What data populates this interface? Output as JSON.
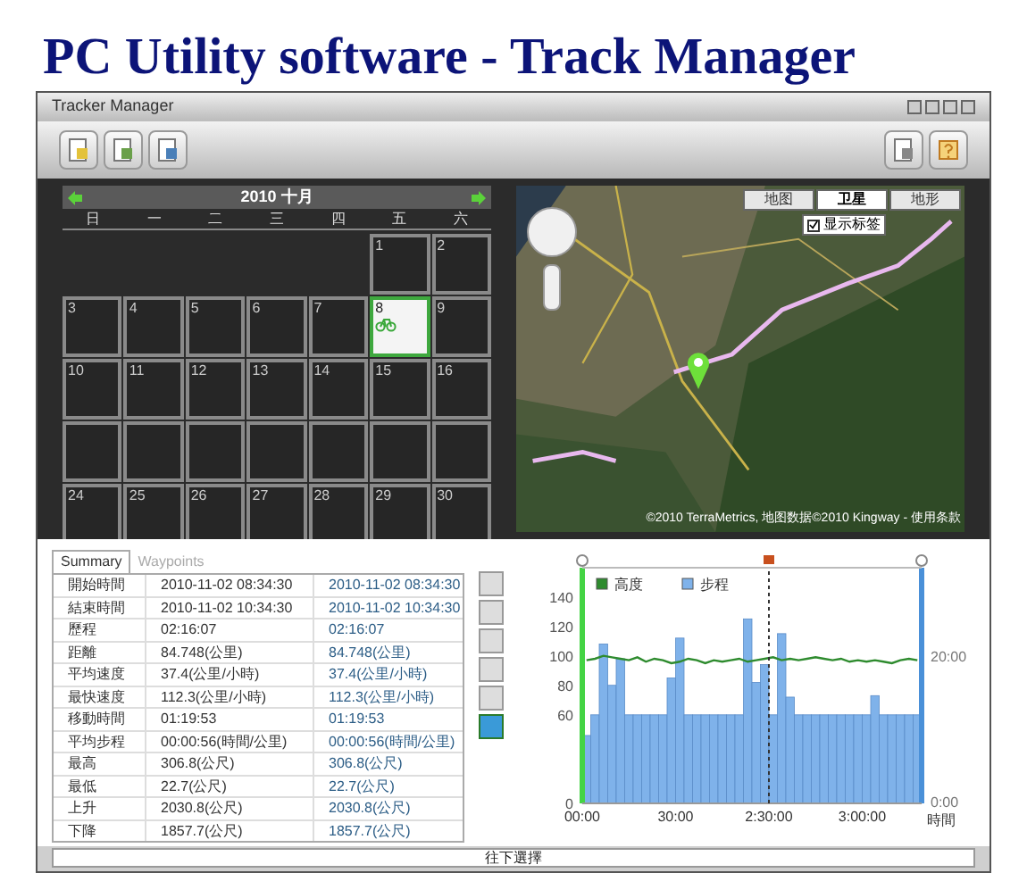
{
  "banner": {
    "title": "PC Utility software - Track Manager"
  },
  "window": {
    "title": "Tracker Manager"
  },
  "calendar": {
    "month": "2010 十月",
    "weekdays": [
      "日",
      "一",
      "二",
      "三",
      "四",
      "五",
      "六"
    ],
    "weeks": [
      [
        {
          "kind": "blank"
        },
        {
          "kind": "blank"
        },
        {
          "kind": "blank"
        },
        {
          "kind": "blank"
        },
        {
          "kind": "blank"
        },
        {
          "kind": "day",
          "day": "1",
          "selected": false
        },
        {
          "kind": "day",
          "day": "2",
          "selected": false
        }
      ],
      [
        {
          "kind": "day",
          "day": "3",
          "selected": false
        },
        {
          "kind": "day",
          "day": "4",
          "selected": false
        },
        {
          "kind": "day",
          "day": "5",
          "selected": false
        },
        {
          "kind": "day",
          "day": "6",
          "selected": false
        },
        {
          "kind": "day",
          "day": "7",
          "selected": false
        },
        {
          "kind": "track",
          "day": "8",
          "selected": true
        },
        {
          "kind": "day",
          "day": "9",
          "selected": false
        }
      ],
      [
        {
          "kind": "day",
          "day": "10",
          "selected": false
        },
        {
          "kind": "day",
          "day": "11",
          "selected": false
        },
        {
          "kind": "day",
          "day": "12",
          "selected": false
        },
        {
          "kind": "day",
          "day": "13",
          "selected": false
        },
        {
          "kind": "day",
          "day": "14",
          "selected": false
        },
        {
          "kind": "day",
          "day": "15",
          "selected": false
        },
        {
          "kind": "day",
          "day": "16",
          "selected": false
        }
      ],
      [
        {
          "kind": "empty"
        },
        {
          "kind": "empty"
        },
        {
          "kind": "empty"
        },
        {
          "kind": "empty"
        },
        {
          "kind": "empty"
        },
        {
          "kind": "empty"
        },
        {
          "kind": "empty"
        }
      ],
      [
        {
          "kind": "day",
          "day": "24",
          "selected": false
        },
        {
          "kind": "day",
          "day": "25",
          "selected": false
        },
        {
          "kind": "day",
          "day": "26",
          "selected": false
        },
        {
          "kind": "day",
          "day": "27",
          "selected": false
        },
        {
          "kind": "day",
          "day": "28",
          "selected": false
        },
        {
          "kind": "day",
          "day": "29",
          "selected": false
        },
        {
          "kind": "day",
          "day": "30",
          "selected": false
        }
      ]
    ]
  },
  "map": {
    "types": [
      {
        "label": "地图",
        "selected": false
      },
      {
        "label": "卫星",
        "selected": true
      },
      {
        "label": "地形",
        "selected": false
      }
    ],
    "show_labels": {
      "label": "显示标签",
      "checked": true
    },
    "attribution": "©2010 TerraMetrics, 地图数据©2010 Kingway - 使用条款"
  },
  "tabs": [
    {
      "label": "Summary",
      "selected": true
    },
    {
      "label": "Waypoints",
      "selected": false
    }
  ],
  "summary_rows": [
    [
      "開始時間",
      "2010-11-02 08:34:30",
      "2010-11-02 08:34:30"
    ],
    [
      "結束時間",
      "2010-11-02 10:34:30",
      "2010-11-02 10:34:30"
    ],
    [
      "歷程",
      "02:16:07",
      "02:16:07"
    ],
    [
      "距離",
      "84.748(公里)",
      "84.748(公里)"
    ],
    [
      "平均速度",
      "37.4(公里/小時)",
      "37.4(公里/小時)"
    ],
    [
      "最快速度",
      "112.3(公里/小時)",
      "112.3(公里/小時)"
    ],
    [
      "移動時間",
      "01:19:53",
      "01:19:53"
    ],
    [
      "平均步程",
      "00:00:56(時間/公里)",
      "00:00:56(時間/公里)"
    ],
    [
      "最高",
      "306.8(公尺)",
      "306.8(公尺)"
    ],
    [
      "最低",
      "22.7(公尺)",
      "22.7(公尺)"
    ],
    [
      "上升",
      "2030.8(公尺)",
      "2030.8(公尺)"
    ],
    [
      "下降",
      "1857.7(公尺)",
      "1857.7(公尺)"
    ]
  ],
  "chart": {
    "right_axis": [
      "20:00",
      "0:00"
    ],
    "chart_data": {
      "type": "bar",
      "xlabel": "時間",
      "legend": "top left",
      "ylim": [
        0,
        150
      ],
      "yticks": [
        0,
        60,
        80,
        100,
        120,
        140
      ],
      "categories": [
        "00:00",
        null,
        null,
        null,
        null,
        null,
        null,
        null,
        null,
        null,
        null,
        "30:00",
        null,
        null,
        null,
        null,
        null,
        null,
        null,
        null,
        null,
        null,
        "2:30:00",
        null,
        null,
        null,
        null,
        null,
        null,
        null,
        null,
        null,
        null,
        "3:00:00",
        null,
        null,
        null,
        null,
        null,
        null
      ],
      "series": [
        {
          "name": "高度",
          "type": "line",
          "color": "#2e8b2e",
          "values": [
            97,
            98,
            100,
            99,
            98,
            97,
            99,
            96,
            98,
            97,
            95,
            96,
            98,
            97,
            95,
            97,
            96,
            97,
            98,
            96,
            97,
            98,
            99,
            97,
            98,
            97,
            98,
            99,
            98,
            97,
            98,
            96,
            97,
            96,
            97,
            96,
            95,
            97,
            98,
            97
          ]
        },
        {
          "name": "步程",
          "type": "bar",
          "color": "#7fb2ea",
          "values": [
            46,
            60,
            108,
            80,
            98,
            60,
            60,
            60,
            60,
            60,
            85,
            112,
            60,
            60,
            60,
            60,
            60,
            60,
            60,
            125,
            82,
            94,
            60,
            115,
            72,
            60,
            60,
            60,
            60,
            60,
            60,
            60,
            60,
            60,
            73,
            60,
            60,
            60,
            60,
            60
          ]
        }
      ]
    }
  },
  "status_bar": {
    "text": "往下選擇"
  }
}
